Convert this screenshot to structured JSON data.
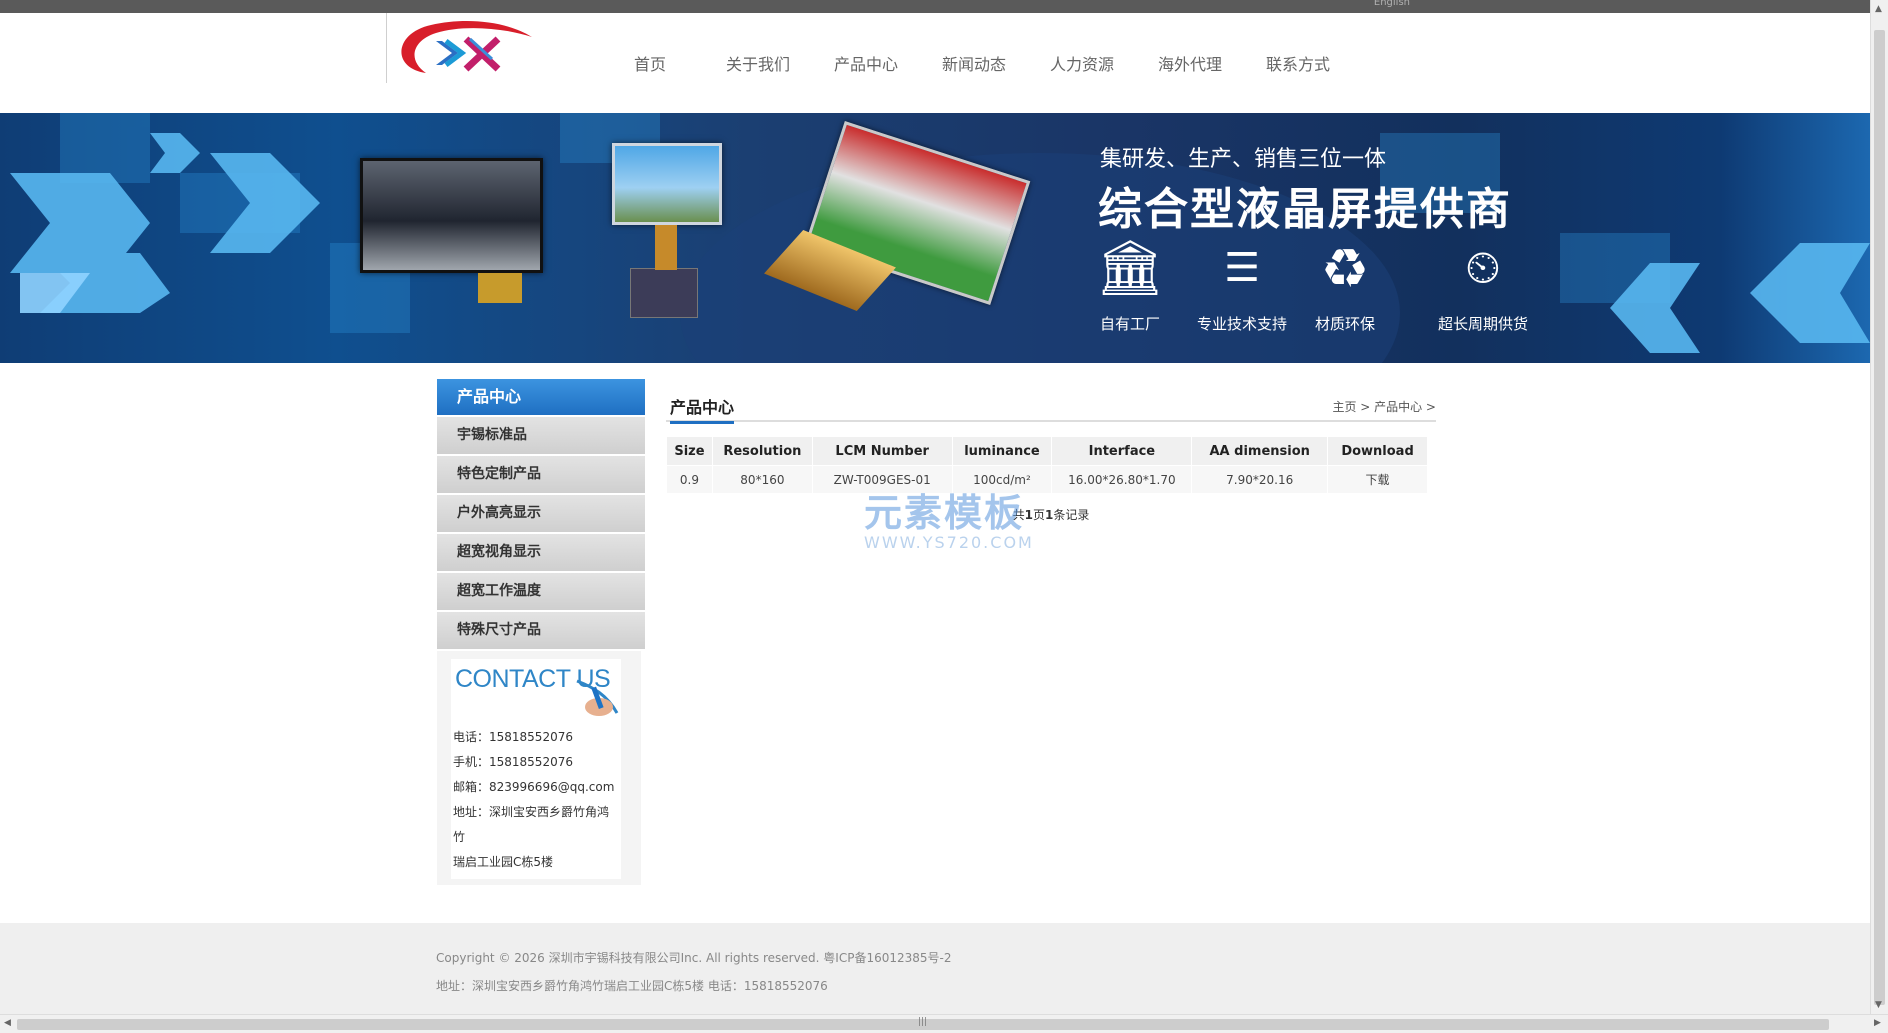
{
  "header": {
    "language_link": "English",
    "nav": [
      "首页",
      "关于我们",
      "产品中心",
      "新闻动态",
      "人力资源",
      "海外代理",
      "联系方式"
    ]
  },
  "banner": {
    "tagline": "集研发、生产、销售三位一体",
    "headline": "综合型液晶屏提供商",
    "features": [
      {
        "label": "自有工厂",
        "icon": "factory-icon"
      },
      {
        "label": "专业技术支持",
        "icon": "professional-icon"
      },
      {
        "label": "材质环保",
        "icon": "recycle-icon"
      },
      {
        "label": "超长周期供货",
        "icon": "clock-person-icon"
      }
    ]
  },
  "sidebar": {
    "title": "产品中心",
    "items": [
      "宇锡标准品",
      "特色定制产品",
      "户外高亮显示",
      "超宽视角显示",
      "超宽工作温度",
      "特殊尺寸产品"
    ],
    "contact": {
      "heading": "CONTACT US",
      "phone": "电话：15818552076",
      "mobile": "手机：15818552076",
      "email": "邮箱：823996696@qq.com",
      "address_1": "地址：深圳宝安西乡爵竹角鸿竹",
      "address_2": "瑞启工业园C栋5楼"
    }
  },
  "main": {
    "title": "产品中心",
    "breadcrumb": "主页 > 产品中心 >",
    "table": {
      "columns": [
        "Size",
        "Resolution",
        "LCM Number",
        "luminance",
        "Interface",
        "AA dimension",
        "Download"
      ],
      "rows": [
        [
          "0.9",
          "80*160",
          "ZW-T009GES-01",
          "100cd/m²",
          "16.00*26.80*1.70",
          "7.90*20.16",
          "下载"
        ]
      ]
    },
    "pager": {
      "prefix": "共",
      "pages": "1",
      "mid": "页",
      "records": "1",
      "suffix": "条记录"
    }
  },
  "watermark": {
    "line1": "元素模板",
    "line2": "WWW.YS720.COM"
  },
  "footer": {
    "copyright": "Copyright © 2026 深圳市宇锡科技有限公司Inc. All rights reserved. 粤ICP备16012385号-2",
    "address": "地址：深圳宝安西乡爵竹角鸿竹瑞启工业园C栋5楼 电话：15818552076"
  },
  "colors": {
    "accent": "#1f6fc2",
    "banner_dark": "#12305d",
    "footer_bg": "#efefef"
  }
}
